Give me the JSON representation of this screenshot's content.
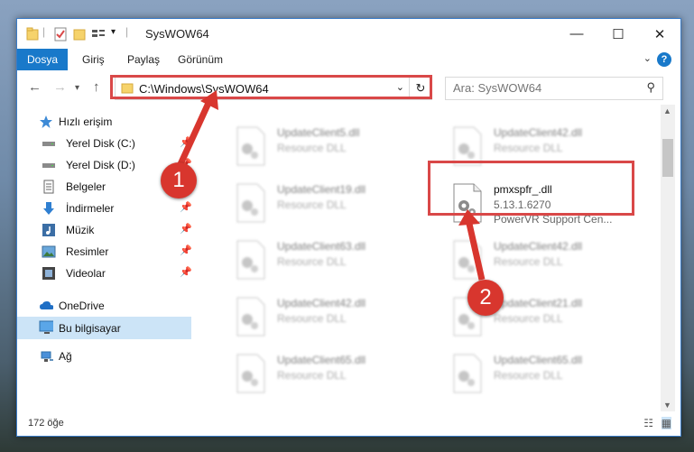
{
  "window": {
    "title": "SysWOW64"
  },
  "ribbon": {
    "tabs": [
      "Dosya",
      "Giriş",
      "Paylaş",
      "Görünüm"
    ],
    "help": "?"
  },
  "address": {
    "path": "C:\\Windows\\SysWOW64"
  },
  "search": {
    "placeholder": "Ara: SysWOW64"
  },
  "sidebar": {
    "items": [
      {
        "label": "Hızlı erişim",
        "icon": "star-icon",
        "pinned": false
      },
      {
        "label": "Yerel Disk (C:)",
        "icon": "drive-icon",
        "pinned": true
      },
      {
        "label": "Yerel Disk (D:)",
        "icon": "drive-icon",
        "pinned": true
      },
      {
        "label": "Belgeler",
        "icon": "documents-icon",
        "pinned": true
      },
      {
        "label": "İndirmeler",
        "icon": "download-icon",
        "pinned": true
      },
      {
        "label": "Müzik",
        "icon": "music-icon",
        "pinned": true
      },
      {
        "label": "Resimler",
        "icon": "pictures-icon",
        "pinned": true
      },
      {
        "label": "Videolar",
        "icon": "videos-icon",
        "pinned": true
      },
      {
        "label": "OneDrive",
        "icon": "cloud-icon",
        "pinned": false
      },
      {
        "label": "Bu bilgisayar",
        "icon": "computer-icon",
        "pinned": false,
        "selected": true
      },
      {
        "label": "Ağ",
        "icon": "network-icon",
        "pinned": false
      }
    ]
  },
  "files": [
    {
      "name": "UpdateClient5.dll",
      "desc": "Resource DLL"
    },
    {
      "name": "UpdateClient42.dll",
      "desc": "Resource DLL"
    },
    {
      "name": "UpdateClient19.dll",
      "desc": "Resource DLL"
    },
    {
      "name": "pmxspfr_.dll",
      "desc": "5.13.1.6270",
      "desc2": "PowerVR Support Cen..."
    },
    {
      "name": "UpdateClient63.dll",
      "desc": "Resource DLL"
    },
    {
      "name": "UpdateClient42.dll",
      "desc": "Resource DLL"
    },
    {
      "name": "UpdateClient42.dll",
      "desc": "Resource DLL"
    },
    {
      "name": "UpdateClient21.dll",
      "desc": "Resource DLL"
    },
    {
      "name": "UpdateClient65.dll",
      "desc": "Resource DLL"
    },
    {
      "name": "UpdateClient65.dll",
      "desc": "Resource DLL"
    }
  ],
  "status": {
    "count": "172 öğe"
  },
  "markers": [
    "1",
    "2"
  ],
  "colors": {
    "accent": "#1979ca",
    "highlight": "#d94848",
    "marker": "#d8362e"
  }
}
